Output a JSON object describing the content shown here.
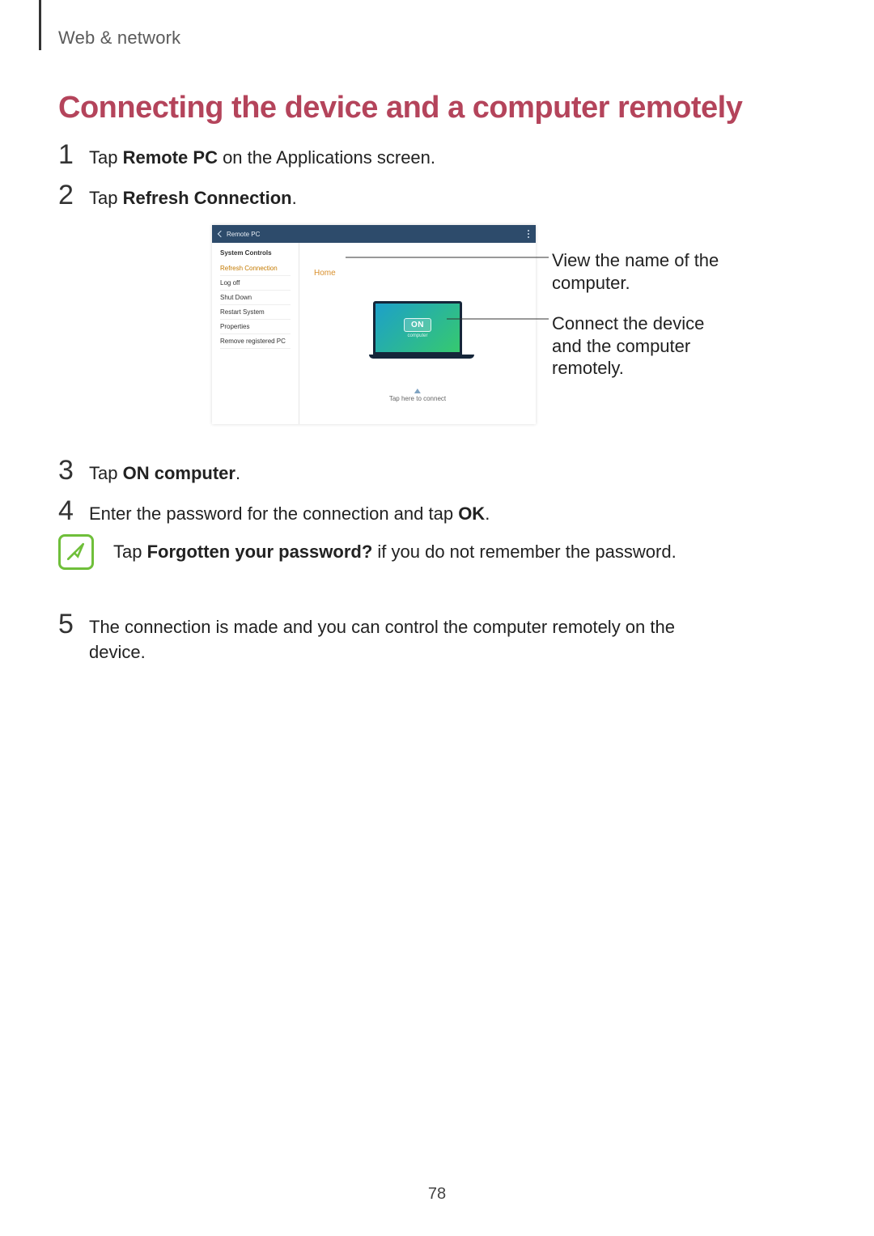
{
  "breadcrumb": "Web & network",
  "heading": "Connecting the device and a computer remotely",
  "steps": {
    "s1": {
      "num": "1",
      "pre": "Tap ",
      "bold": "Remote PC",
      "post": " on the Applications screen."
    },
    "s2": {
      "num": "2",
      "pre": "Tap ",
      "bold": "Refresh Connection",
      "post": "."
    },
    "s3": {
      "num": "3",
      "pre": "Tap ",
      "bold": "ON computer",
      "post": "."
    },
    "s4": {
      "num": "4",
      "pre": "Enter the password for the connection and tap ",
      "bold": "OK",
      "post": "."
    },
    "s5": {
      "num": "5",
      "text": "The connection is made and you can control the computer remotely on the device."
    }
  },
  "note": {
    "pre": "Tap ",
    "bold": "Forgotten your password?",
    "post": " if you do not remember the password."
  },
  "tablet": {
    "title": "Remote PC",
    "section_label": "System Controls",
    "sidebar": {
      "refresh": "Refresh Connection",
      "logoff": "Log off",
      "shutdown": "Shut Down",
      "restart": "Restart System",
      "props": "Properties",
      "remove": "Remove registered PC"
    },
    "home": "Home",
    "on_label": "ON",
    "on_sub": "computer",
    "tap_hint": "Tap here to connect"
  },
  "callouts": {
    "c1": "View the name of the computer.",
    "c2": "Connect the device and the computer remotely."
  },
  "page_number": "78"
}
